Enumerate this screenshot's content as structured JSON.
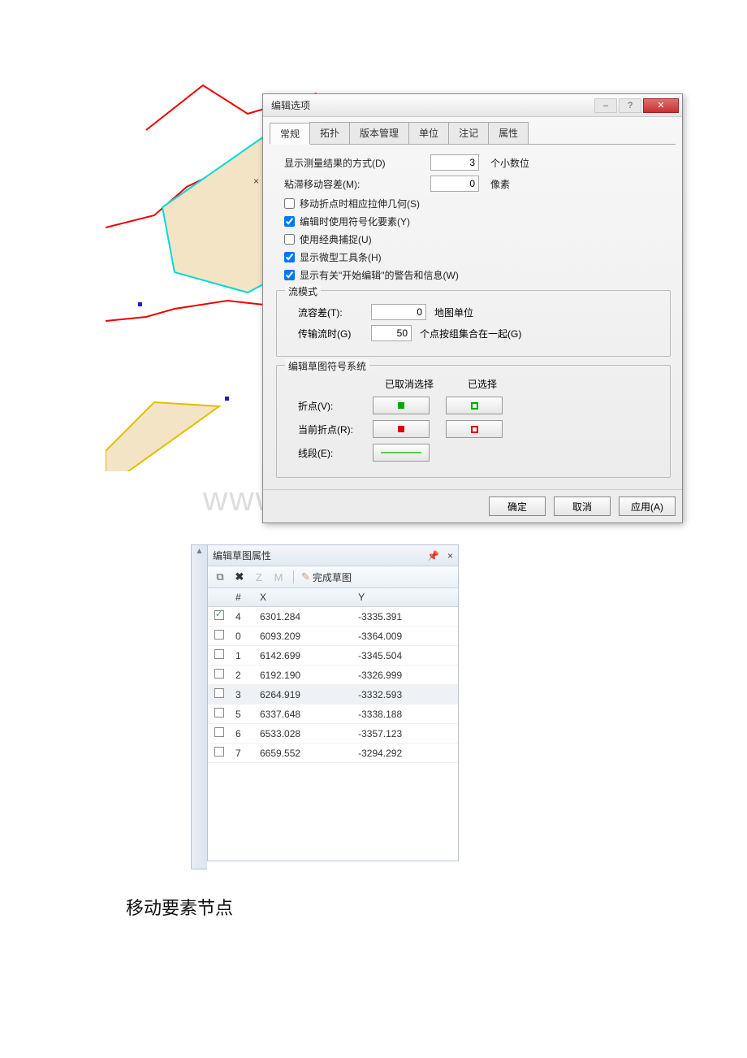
{
  "watermark": "www.bdocx.com",
  "dialog": {
    "title": "编辑选项",
    "tabs": [
      "常规",
      "拓扑",
      "版本管理",
      "单位",
      "注记",
      "属性"
    ],
    "display_method_label": "显示测量结果的方式(D)",
    "display_method_value": "3",
    "display_method_unit": "个小数位",
    "sticky_label": "粘滞移动容差(M):",
    "sticky_value": "0",
    "sticky_unit": "像素",
    "checks": [
      {
        "checked": false,
        "label": "移动折点时相应拉伸几何(S)"
      },
      {
        "checked": true,
        "label": "编辑时使用符号化要素(Y)"
      },
      {
        "checked": false,
        "label": "使用经典捕捉(U)"
      },
      {
        "checked": true,
        "label": "显示微型工具条(H)"
      },
      {
        "checked": true,
        "label": "显示有关\"开始编辑\"的警告和信息(W)"
      }
    ],
    "stream_legend": "流模式",
    "stream_tol_label": "流容差(T):",
    "stream_tol_value": "0",
    "stream_tol_unit": "地图单位",
    "stream_group_label": "传输流时(G)",
    "stream_group_value": "50",
    "stream_group_unit": "个点按组集合在一起(G)",
    "symbol_legend": "编辑草图符号系统",
    "symbol_head1": "已取消选择",
    "symbol_head2": "已选择",
    "symbol_rows": [
      {
        "label": "折点(V):"
      },
      {
        "label": "当前折点(R):"
      },
      {
        "label": "线段(E):"
      }
    ],
    "ok": "确定",
    "cancel": "取消",
    "apply": "应用(A)"
  },
  "sketch": {
    "title": "编辑草图属性",
    "pin": "⫿",
    "close": "×",
    "finish_label": "完成草图",
    "headers": {
      "hash": "#",
      "x": "X",
      "y": "Y"
    },
    "rows": [
      {
        "checked": true,
        "idx": "4",
        "x": "6301.284",
        "y": "-3335.391"
      },
      {
        "checked": false,
        "idx": "0",
        "x": "6093.209",
        "y": "-3364.009"
      },
      {
        "checked": false,
        "idx": "1",
        "x": "6142.699",
        "y": "-3345.504"
      },
      {
        "checked": false,
        "idx": "2",
        "x": "6192.190",
        "y": "-3326.999"
      },
      {
        "checked": false,
        "idx": "3",
        "x": "6264.919",
        "y": "-3332.593",
        "sel": true
      },
      {
        "checked": false,
        "idx": "5",
        "x": "6337.648",
        "y": "-3338.188"
      },
      {
        "checked": false,
        "idx": "6",
        "x": "6533.028",
        "y": "-3357.123"
      },
      {
        "checked": false,
        "idx": "7",
        "x": "6659.552",
        "y": "-3294.292"
      }
    ]
  },
  "caption": "移动要素节点"
}
